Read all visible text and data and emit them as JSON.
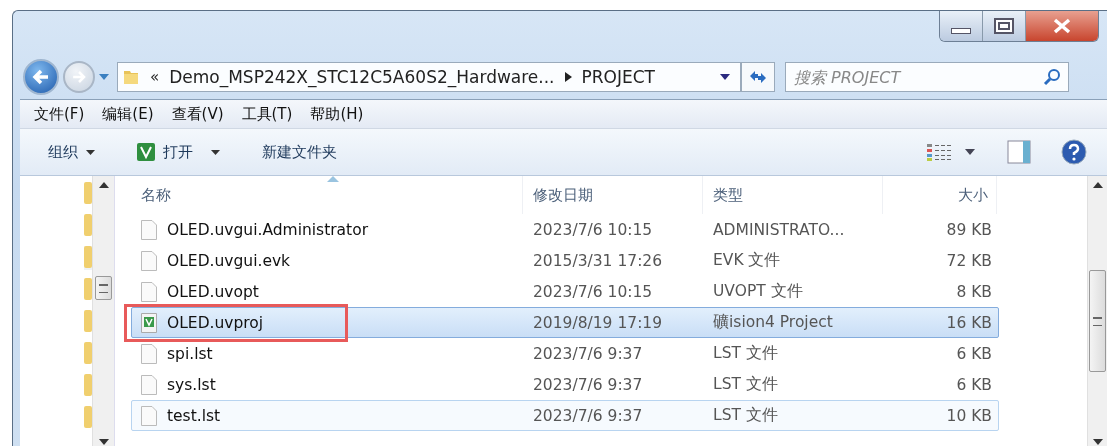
{
  "address_bar": {
    "overflow": "«",
    "crumbs": [
      "Demo_MSP242X_STC12C5A60S2_Hardware...",
      "PROJECT"
    ]
  },
  "search": {
    "placeholder": "搜索 PROJECT"
  },
  "menu_bar": [
    "文件(F)",
    "编辑(E)",
    "查看(V)",
    "工具(T)",
    "帮助(H)"
  ],
  "toolbar": [
    {
      "label": "组织",
      "kind": "menu"
    },
    {
      "label": "打开",
      "kind": "split"
    },
    {
      "label": "新建文件夹",
      "kind": "plain"
    }
  ],
  "table": {
    "columns": [
      "名称",
      "修改日期",
      "类型",
      "大小"
    ],
    "rows": [
      {
        "name": "OLED.uvgui.Administrator",
        "date": "2023/7/6 10:15",
        "type": "ADMINISTRATO...",
        "size": "89 KB",
        "kind": "file",
        "selected": false,
        "hovered": false,
        "annotated": false
      },
      {
        "name": "OLED.uvgui.evk",
        "date": "2015/3/31 17:26",
        "type": "EVK 文件",
        "size": "72 KB",
        "kind": "file",
        "selected": false,
        "hovered": false,
        "annotated": false
      },
      {
        "name": "OLED.uvopt",
        "date": "2023/7/6 10:15",
        "type": "UVOPT 文件",
        "size": "8 KB",
        "kind": "file",
        "selected": false,
        "hovered": false,
        "annotated": false
      },
      {
        "name": "OLED.uvproj",
        "date": "2019/8/19 17:19",
        "type": "礦ision4 Project",
        "size": "16 KB",
        "kind": "project",
        "selected": true,
        "hovered": false,
        "annotated": true
      },
      {
        "name": "spi.lst",
        "date": "2023/7/6 9:37",
        "type": "LST 文件",
        "size": "6 KB",
        "kind": "file",
        "selected": false,
        "hovered": false,
        "annotated": false
      },
      {
        "name": "sys.lst",
        "date": "2023/7/6 9:37",
        "type": "LST 文件",
        "size": "6 KB",
        "kind": "file",
        "selected": false,
        "hovered": false,
        "annotated": false
      },
      {
        "name": "test.lst",
        "date": "2023/7/6 9:37",
        "type": "LST 文件",
        "size": "10 KB",
        "kind": "file",
        "selected": false,
        "hovered": true,
        "annotated": false
      }
    ]
  }
}
